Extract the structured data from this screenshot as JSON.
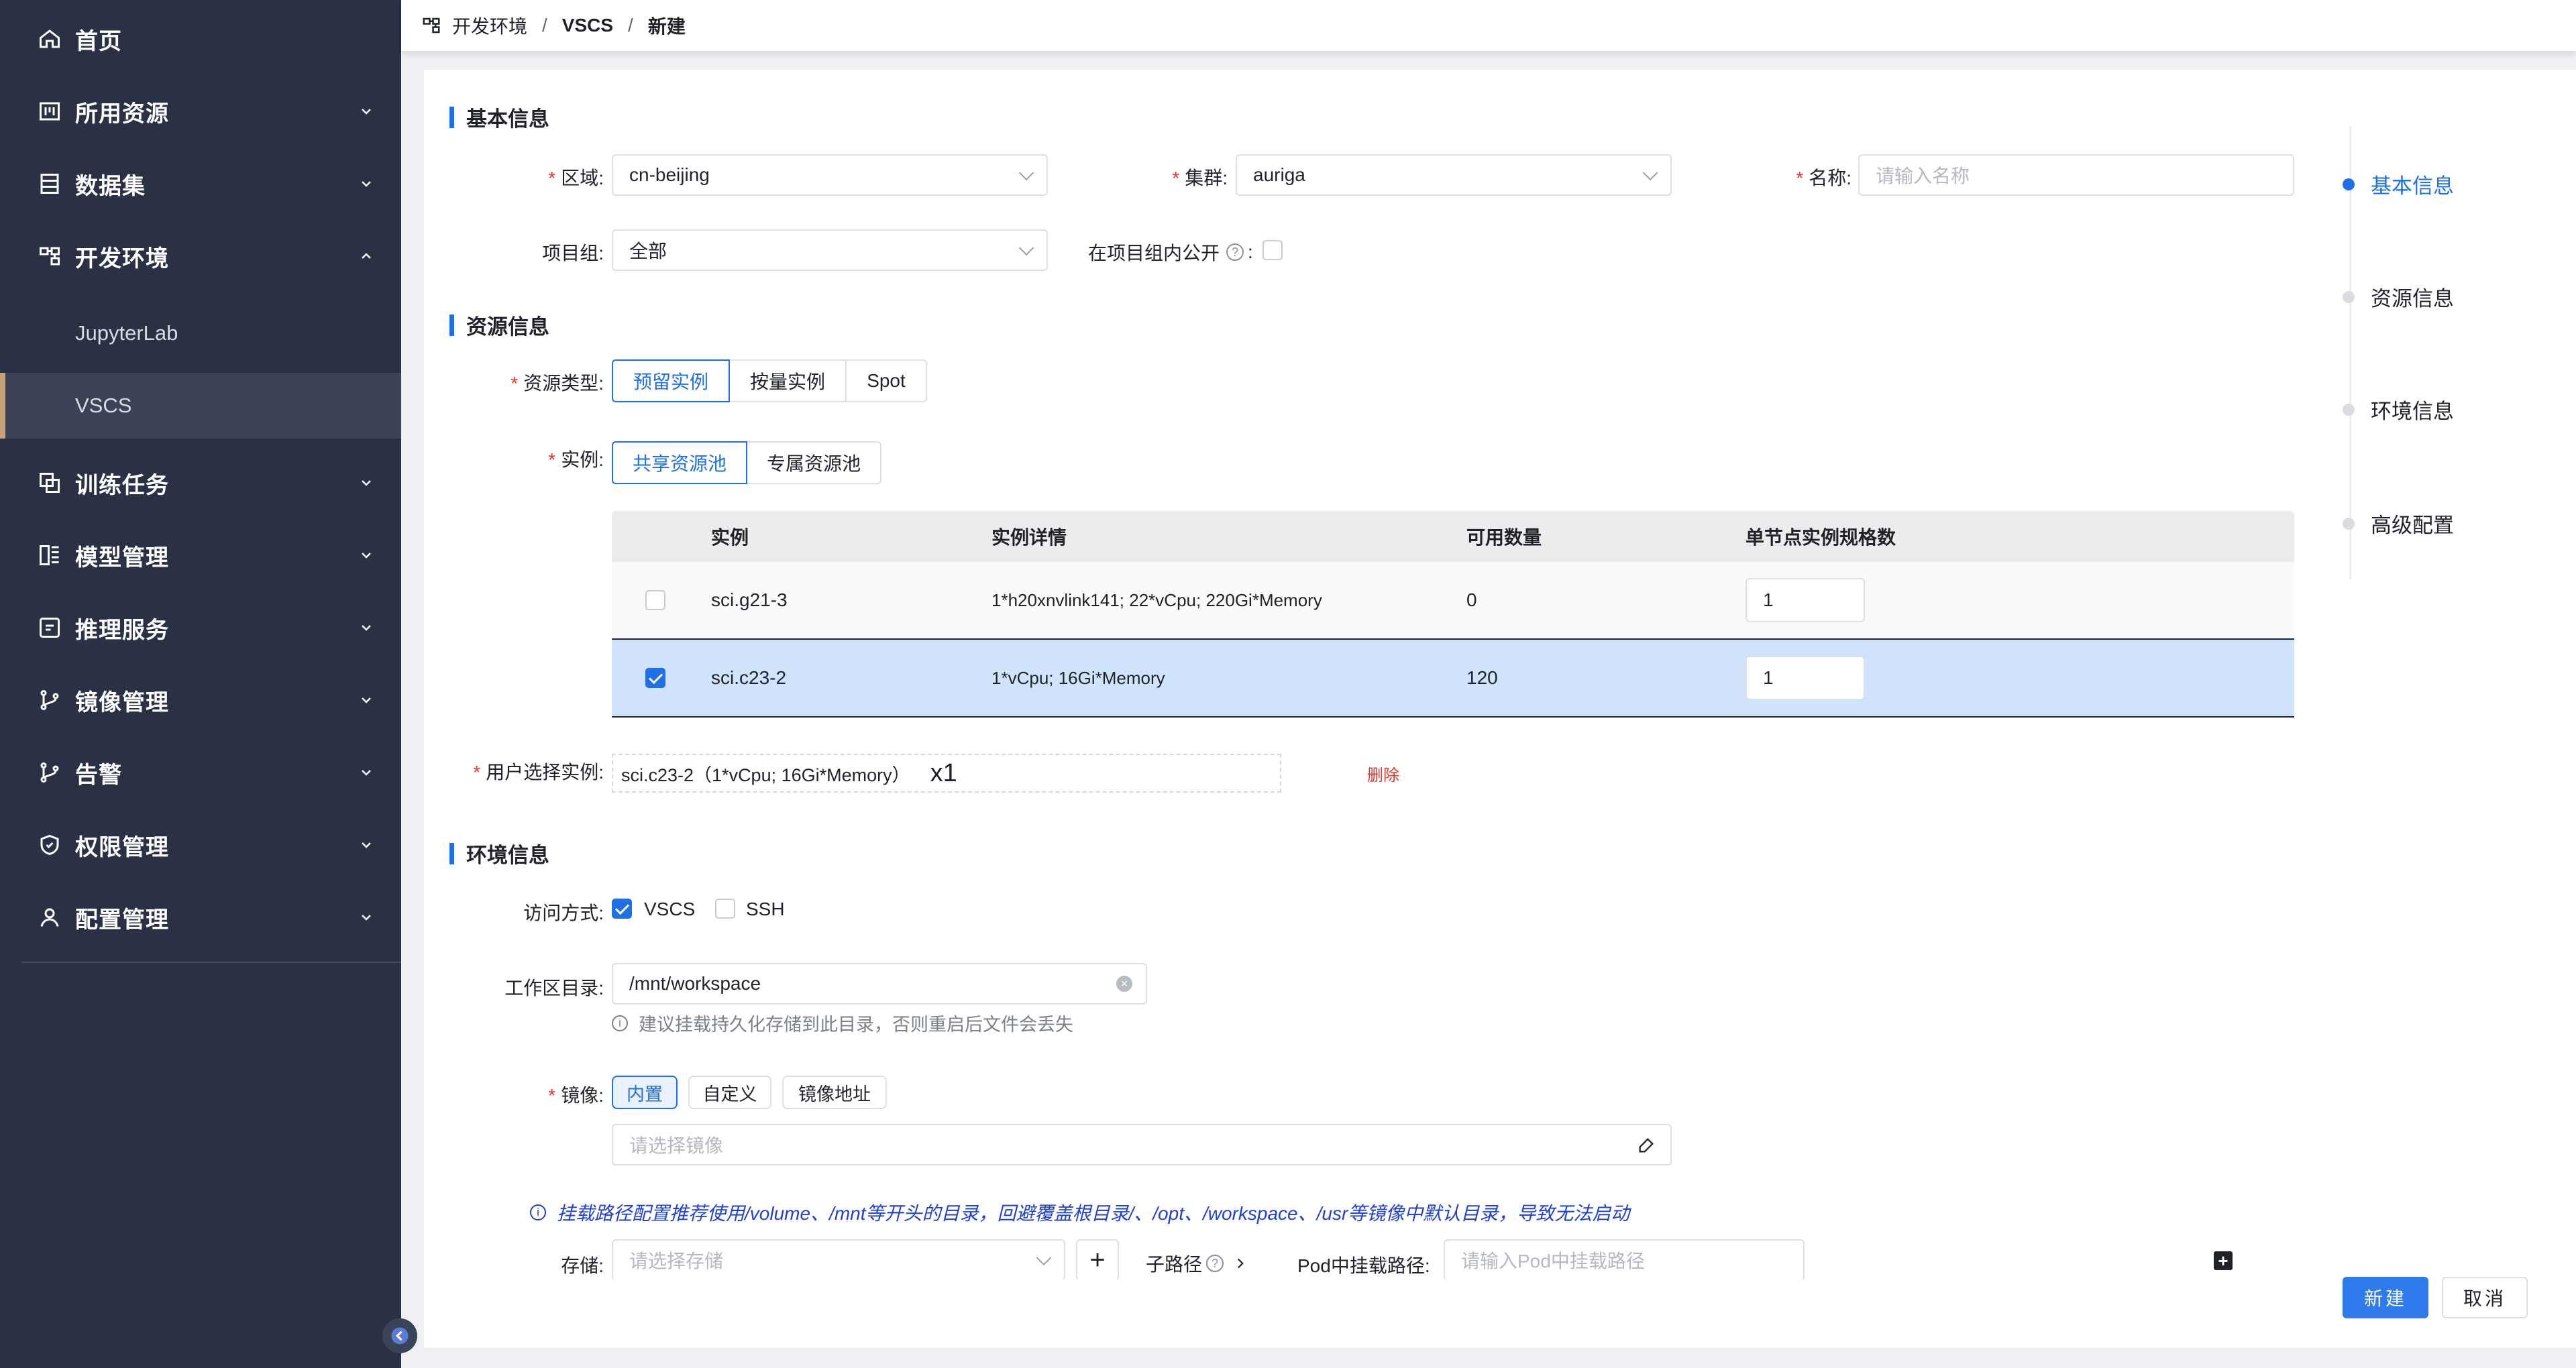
{
  "sidebar": {
    "items": [
      {
        "label": "首页",
        "icon": "home-icon"
      },
      {
        "label": "所用资源",
        "icon": "resource-icon"
      },
      {
        "label": "数据集",
        "icon": "dataset-icon"
      },
      {
        "label": "开发环境",
        "icon": "dev-env-icon"
      },
      {
        "label": "训练任务",
        "icon": "training-icon"
      },
      {
        "label": "模型管理",
        "icon": "model-icon"
      },
      {
        "label": "推理服务",
        "icon": "inference-icon"
      },
      {
        "label": "镜像管理",
        "icon": "image-icon"
      },
      {
        "label": "告警",
        "icon": "alert-icon"
      },
      {
        "label": "权限管理",
        "icon": "permission-icon"
      },
      {
        "label": "配置管理",
        "icon": "config-icon"
      }
    ],
    "sub_items": [
      {
        "label": "JupyterLab"
      },
      {
        "label": "VSCS"
      }
    ]
  },
  "breadcrumb": {
    "root": "开发环境",
    "mid": "VSCS",
    "current": "新建",
    "sep": "/"
  },
  "basic": {
    "title": "基本信息",
    "region_label": "区域",
    "region_value": "cn-beijing",
    "cluster_label": "集群",
    "cluster_value": "auriga",
    "name_label": "名称",
    "name_placeholder": "请输入名称",
    "group_label": "项目组",
    "group_value": "全部",
    "public_label": "在项目组内公开"
  },
  "resource": {
    "title": "资源信息",
    "type_label": "资源类型",
    "types": [
      "预留实例",
      "按量实例",
      "Spot"
    ],
    "instance_label": "实例",
    "pools": [
      "共享资源池",
      "专属资源池"
    ],
    "table": {
      "headers": [
        "实例",
        "实例详情",
        "可用数量",
        "单节点实例规格数"
      ],
      "rows": [
        {
          "name": "sci.g21-3",
          "detail": "1*h20xnvlink141; 22*vCpu; 220Gi*Memory",
          "available": "0",
          "qty": "1",
          "checked": false
        },
        {
          "name": "sci.c23-2",
          "detail": "1*vCpu; 16Gi*Memory",
          "available": "120",
          "qty": "1",
          "checked": true
        }
      ]
    },
    "user_choice_label": "用户选择实例",
    "user_choice_value": "sci.c23-2（1*vCpu; 16Gi*Memory）",
    "user_choice_count": "x1",
    "delete_label": "删除"
  },
  "env": {
    "title": "环境信息",
    "access_label": "访问方式",
    "access_options": [
      {
        "label": "VSCS",
        "checked": true
      },
      {
        "label": "SSH",
        "checked": false
      }
    ],
    "workspace_label": "工作区目录",
    "workspace_value": "/mnt/workspace",
    "workspace_hint": "建议挂载持久化存储到此目录，否则重启后文件会丢失",
    "image_label": "镜像",
    "image_tabs": [
      "内置",
      "自定义",
      "镜像地址"
    ],
    "image_placeholder": "请选择镜像",
    "mount_notice": "挂载路径配置推荐使用/volume、/mnt等开头的目录，回避覆盖根目录/、/opt、/workspace、/usr等镜像中默认目录，导致无法启动",
    "storage_label": "存储",
    "storage_placeholder": "请选择存储",
    "subpath_label": "子路径",
    "pod_path_label": "Pod中挂载路径",
    "pod_path_placeholder": "请输入Pod中挂载路径"
  },
  "anchor": {
    "items": [
      "基本信息",
      "资源信息",
      "环境信息",
      "高级配置"
    ],
    "active": 0
  },
  "actions": {
    "create": "新建",
    "cancel": "取消"
  },
  "colors": {
    "primary": "#1f6fe6",
    "sidebar_bg": "#2a3144",
    "required": "#e5382f"
  }
}
